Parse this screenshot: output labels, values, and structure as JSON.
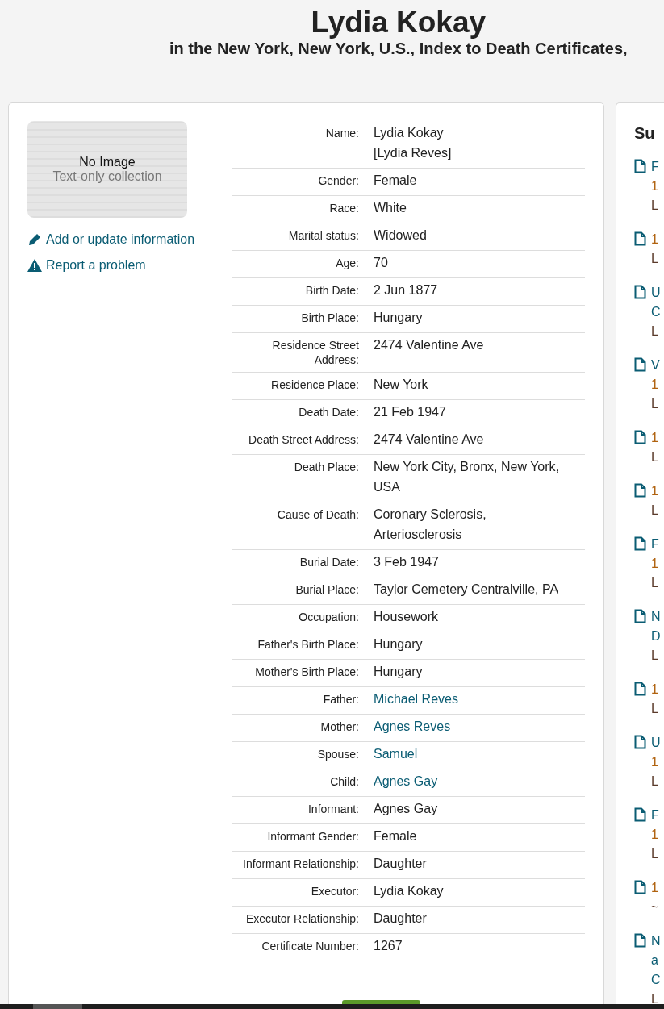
{
  "header": {
    "title": "Lydia Kokay",
    "subtitle": "in the New York, New York, U.S., Index to Death Certificates,"
  },
  "image": {
    "title": "No Image",
    "caption": "Text-only collection"
  },
  "actions": [
    {
      "kind": "edit",
      "label": "Add or update information"
    },
    {
      "kind": "warning",
      "label": "Report a problem"
    }
  ],
  "fields": [
    {
      "label": "Name:",
      "value": "Lydia Kokay",
      "also": "[Lydia Reves]",
      "kind": "text"
    },
    {
      "label": "Gender:",
      "value": "Female",
      "kind": "text"
    },
    {
      "label": "Race:",
      "value": "White",
      "kind": "text"
    },
    {
      "label": "Marital status:",
      "value": "Widowed",
      "kind": "text"
    },
    {
      "label": "Age:",
      "value": "70",
      "kind": "text"
    },
    {
      "label": "Birth Date:",
      "value": "2 Jun 1877",
      "kind": "text"
    },
    {
      "label": "Birth Place:",
      "value": "Hungary",
      "kind": "text"
    },
    {
      "label": "Residence Street Address:",
      "value": "2474 Valentine Ave",
      "kind": "text"
    },
    {
      "label": "Residence Place:",
      "value": "New York",
      "kind": "text"
    },
    {
      "label": "Death Date:",
      "value": "21 Feb 1947",
      "kind": "text"
    },
    {
      "label": "Death Street Address:",
      "value": "2474 Valentine Ave",
      "kind": "text"
    },
    {
      "label": "Death Place:",
      "value": "New York City, Bronx, New York, USA",
      "kind": "text"
    },
    {
      "label": "Cause of Death:",
      "value": "Coronary Sclerosis, Arteriosclerosis",
      "kind": "text"
    },
    {
      "label": "Burial Date:",
      "value": "3 Feb 1947",
      "kind": "text"
    },
    {
      "label": "Burial Place:",
      "value": "Taylor Cemetery Centralville, PA",
      "kind": "text"
    },
    {
      "label": "Occupation:",
      "value": "Housework",
      "kind": "text"
    },
    {
      "label": "Father's Birth Place:",
      "value": "Hungary",
      "kind": "text"
    },
    {
      "label": "Mother's Birth Place:",
      "value": "Hungary",
      "kind": "text"
    },
    {
      "label": "Father:",
      "value": "Michael Reves",
      "kind": "link"
    },
    {
      "label": "Mother:",
      "value": "Agnes Reves",
      "kind": "link"
    },
    {
      "label": "Spouse:",
      "value": "Samuel",
      "kind": "link"
    },
    {
      "label": "Child:",
      "value": "Agnes Gay",
      "kind": "link"
    },
    {
      "label": "Informant:",
      "value": "Agnes Gay",
      "kind": "text"
    },
    {
      "label": "Informant Gender:",
      "value": "Female",
      "kind": "text"
    },
    {
      "label": "Informant Relationship:",
      "value": "Daughter",
      "kind": "text"
    },
    {
      "label": "Executor:",
      "value": "Lydia Kokay",
      "kind": "text"
    },
    {
      "label": "Executor Relationship:",
      "value": "Daughter",
      "kind": "text"
    },
    {
      "label": "Certificate Number:",
      "value": "1267",
      "kind": "text"
    }
  ],
  "suggested": {
    "heading": "Su",
    "items": [
      {
        "lines": [
          {
            "kind": "title",
            "text": "F"
          },
          {
            "kind": "date",
            "text": "1"
          },
          {
            "kind": "place",
            "text": "L"
          }
        ]
      },
      {
        "lines": [
          {
            "kind": "date",
            "text": "1"
          },
          {
            "kind": "place",
            "text": "L"
          }
        ]
      },
      {
        "lines": [
          {
            "kind": "title",
            "text": "U"
          },
          {
            "kind": "title",
            "text": "C"
          },
          {
            "kind": "place",
            "text": "L"
          }
        ]
      },
      {
        "lines": [
          {
            "kind": "title",
            "text": "V"
          },
          {
            "kind": "date",
            "text": "1"
          },
          {
            "kind": "place",
            "text": "L"
          }
        ]
      },
      {
        "lines": [
          {
            "kind": "date",
            "text": "1"
          },
          {
            "kind": "place",
            "text": "L"
          }
        ]
      },
      {
        "lines": [
          {
            "kind": "date",
            "text": "1"
          },
          {
            "kind": "place",
            "text": "L"
          }
        ]
      },
      {
        "lines": [
          {
            "kind": "title",
            "text": "F"
          },
          {
            "kind": "date",
            "text": "1"
          },
          {
            "kind": "place",
            "text": "L"
          }
        ]
      },
      {
        "lines": [
          {
            "kind": "title",
            "text": "N"
          },
          {
            "kind": "title",
            "text": "D"
          },
          {
            "kind": "place",
            "text": "L"
          }
        ]
      },
      {
        "lines": [
          {
            "kind": "date",
            "text": "1"
          },
          {
            "kind": "place",
            "text": "L"
          }
        ]
      },
      {
        "lines": [
          {
            "kind": "title",
            "text": "U"
          },
          {
            "kind": "date",
            "text": "1"
          },
          {
            "kind": "place",
            "text": "L"
          }
        ]
      },
      {
        "lines": [
          {
            "kind": "title",
            "text": "F"
          },
          {
            "kind": "date",
            "text": "1"
          },
          {
            "kind": "place",
            "text": "L"
          }
        ]
      },
      {
        "lines": [
          {
            "kind": "date",
            "text": "1"
          },
          {
            "kind": "place",
            "text": "~"
          }
        ]
      },
      {
        "lines": [
          {
            "kind": "title",
            "text": "N"
          },
          {
            "kind": "title",
            "text": "a"
          },
          {
            "kind": "title",
            "text": "C"
          },
          {
            "kind": "place",
            "text": "L"
          }
        ]
      }
    ]
  }
}
